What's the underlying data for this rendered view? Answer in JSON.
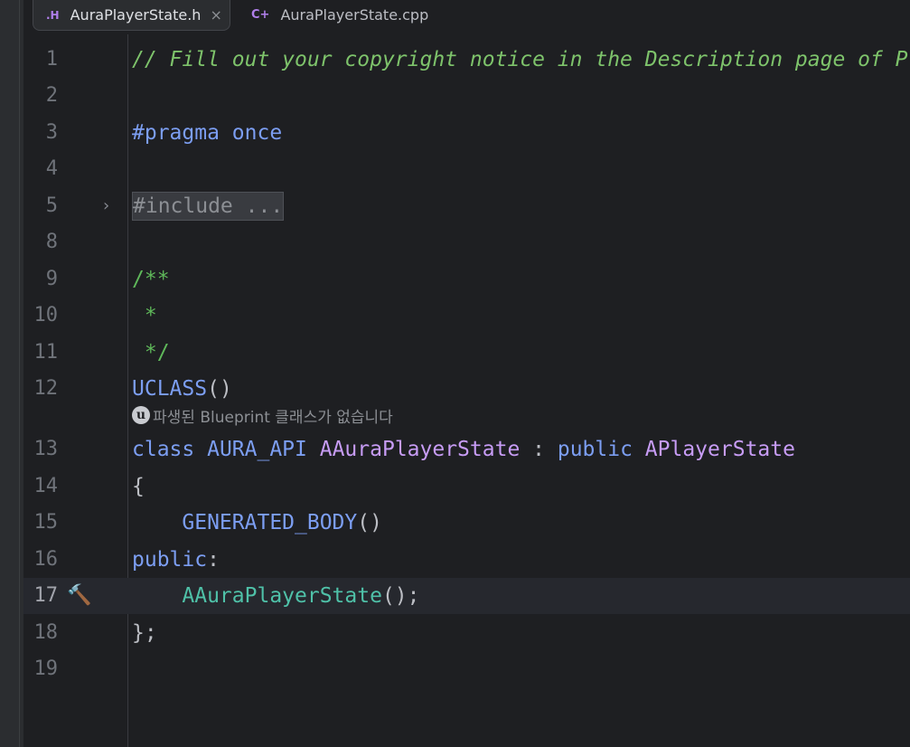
{
  "tabs": [
    {
      "icon": ".H",
      "label": "AuraPlayerState.h",
      "close": "×"
    },
    {
      "icon": "C+",
      "label": "AuraPlayerState.cpp"
    }
  ],
  "editor": {
    "lines": [
      {
        "num": "1",
        "text": "// Fill out your copyright notice in the Description page of P"
      },
      {
        "num": "2",
        "text": ""
      },
      {
        "num": "3",
        "t1": "#pragma",
        "t2": " once"
      },
      {
        "num": "4",
        "text": ""
      },
      {
        "num": "5",
        "text": "#include ..."
      },
      {
        "num": "8",
        "text": ""
      },
      {
        "num": "9",
        "text": "/**"
      },
      {
        "num": "10",
        "text": " *"
      },
      {
        "num": "11",
        "text": " */"
      },
      {
        "num": "12",
        "t1": "UCLASS",
        "t2": "()"
      },
      {
        "num": "13",
        "t1": "class",
        "t2": " AURA_API ",
        "t3": "AAuraPlayerState",
        "t4": " : ",
        "t5": "public",
        "t6": " ",
        "t7": "APlayerState"
      },
      {
        "num": "14",
        "text": "{"
      },
      {
        "num": "15",
        "t1": "    GENERATED_BODY",
        "t2": "()"
      },
      {
        "num": "16",
        "t1": "public",
        "t2": ":"
      },
      {
        "num": "17",
        "t1": "    AAuraPlayerState",
        "t2": "();"
      },
      {
        "num": "18",
        "text": "};"
      },
      {
        "num": "19",
        "text": ""
      }
    ],
    "blueprint_hint": "파생된 Blueprint 클래스가 없습니다",
    "hint_icon": "u"
  }
}
